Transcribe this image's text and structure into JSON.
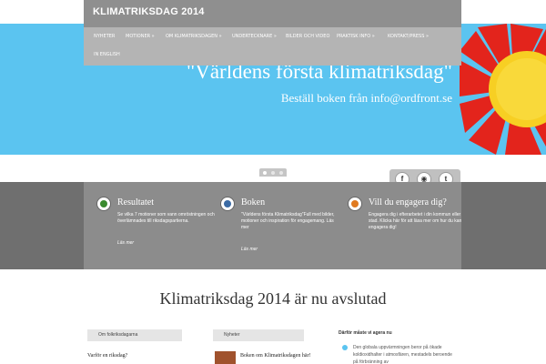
{
  "header": {
    "site_title": "KLIMATRIKSDAG 2014"
  },
  "nav": {
    "items": [
      {
        "label": "Nyheter"
      },
      {
        "label": "Motioner »"
      },
      {
        "label": "Om Klimatriksdagen »"
      },
      {
        "label": "Undertecknare »"
      },
      {
        "label": "Bilder och video"
      },
      {
        "label": "Praktisk info »"
      },
      {
        "label": "Kontakt/Press »"
      },
      {
        "label": "In English"
      }
    ]
  },
  "hero": {
    "quote": "\"Världens första klimatriksdag\"",
    "subtitle": "Beställ boken från info@ordfront.se"
  },
  "social": {
    "facebook": "f",
    "rss": "◉",
    "twitter": "t"
  },
  "features": [
    {
      "title": "Resultatet",
      "text": "Se vilka 7 motioner som vann omröstningen och överlämnades till riksdagspartierna.",
      "more": "Läs mer",
      "icon": "green-circle-icon",
      "color": "#3a8a2e"
    },
    {
      "title": "Boken",
      "text": "\"Världens första Klimatriksdag\"Full med bilder, motioner och inspiration för engagemang. Läs mer",
      "more": "Läs mer",
      "icon": "blue-circle-icon",
      "color": "#3b6ba5"
    },
    {
      "title": "Vill du engagera dig?",
      "text": "Engagera dig i efterarbetet i din kommun eller stad. Klicka här för att läsa mer om hur du kan engagera dig!",
      "more": "",
      "icon": "orange-circle-icon",
      "color": "#e07a1f"
    }
  ],
  "headline": "Klimatriksdag 2014 är nu avslutad",
  "columns": {
    "left_tab": "Om folkriksdagarna",
    "left_link": "Varför en riksdag?",
    "middle_tab": "Nyheter",
    "middle_link": "Boken om Klimatriksdagen här!",
    "right_title": "Därför måste vi agera nu",
    "right_text": "Den globala uppvärmningen beror på ökade koldioxidhalter i atmosfären, mestadels beroende på förbränning av"
  },
  "colors": {
    "hero_blue": "#5bc4f0",
    "nav_grey": "#b4b4b4",
    "features_grey": "#8c8c8c"
  }
}
